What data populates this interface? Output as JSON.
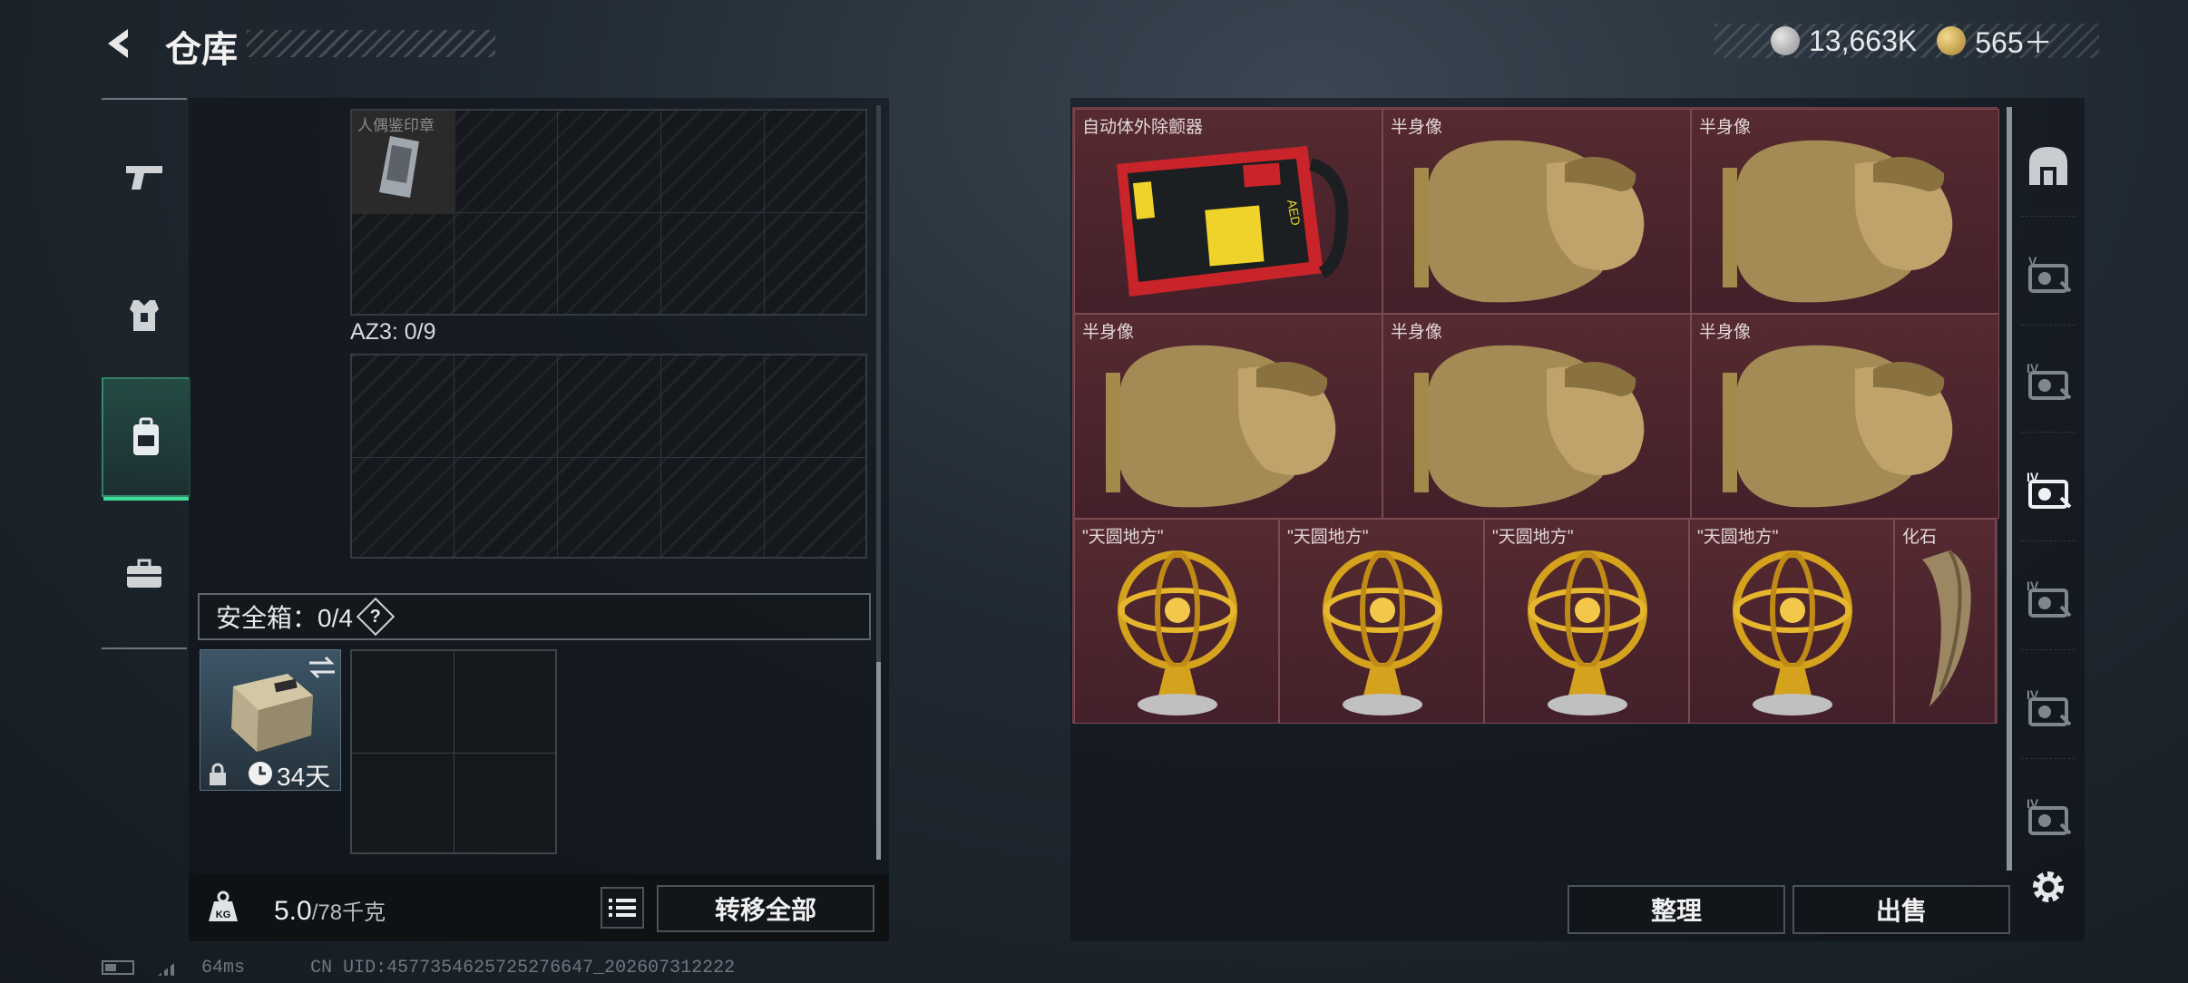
{
  "header": {
    "title": "仓库",
    "currency": {
      "coins": "13,663K",
      "gold": "565＋"
    }
  },
  "tabs": [
    "weapons",
    "armor",
    "backpack",
    "case"
  ],
  "left": {
    "top_item_label": "人偶鉴印章",
    "az3_label": "AZ3: 0/9",
    "safebox": {
      "label": "安全箱：0/4",
      "help": "?",
      "days": "34天"
    },
    "weight": {
      "current": "5.0",
      "max": "/78千克",
      "kg_icon": "KG"
    },
    "transfer_all": "转移全部"
  },
  "items": [
    {
      "label": "自动体外除颤器",
      "type": "aed"
    },
    {
      "label": "半身像",
      "type": "bust"
    },
    {
      "label": "半身像",
      "type": "bust"
    },
    {
      "label": "半身像",
      "type": "bust"
    },
    {
      "label": "半身像",
      "type": "bust"
    },
    {
      "label": "半身像",
      "type": "bust"
    },
    {
      "label": "\"天圆地方\"",
      "type": "globe"
    },
    {
      "label": "\"天圆地方\"",
      "type": "globe"
    },
    {
      "label": "\"天圆地方\"",
      "type": "globe"
    },
    {
      "label": "\"天圆地方\"",
      "type": "globe"
    },
    {
      "label": "化石",
      "type": "fossil"
    }
  ],
  "filters": [
    "all",
    "V",
    "IV",
    "IV",
    "IV",
    "IV",
    "IV"
  ],
  "actions": {
    "sort": "整理",
    "sell": "出售"
  },
  "status": {
    "ping": "64ms",
    "uid": "CN UID:4577354625725276647_202607312222"
  },
  "colors": {
    "accent": "#3fdc98",
    "item_bg": "#4c2126"
  }
}
